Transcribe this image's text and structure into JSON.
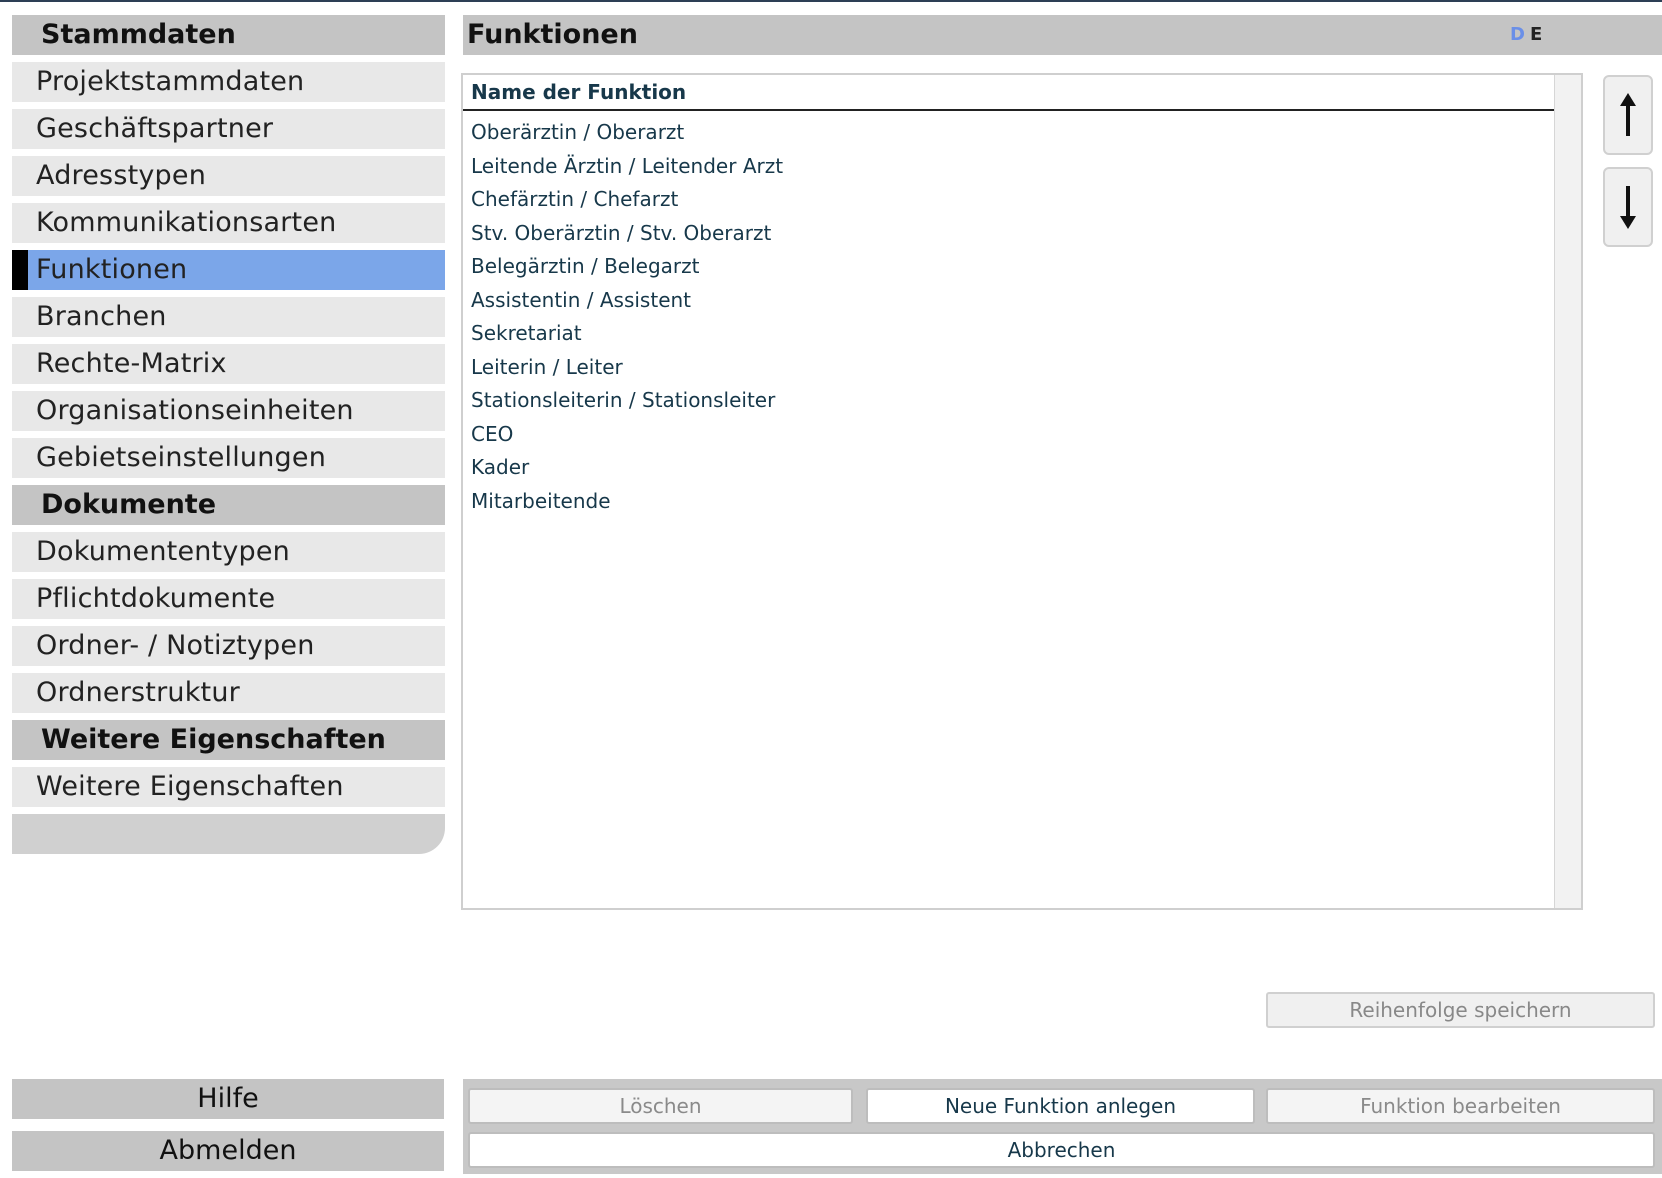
{
  "sidebar": {
    "sections": [
      {
        "title": "Stammdaten",
        "items": [
          "Projektstammdaten",
          "Geschäftspartner",
          "Adresstypen",
          "Kommunikationsarten",
          "Funktionen",
          "Branchen",
          "Rechte-Matrix",
          "Organisationseinheiten",
          "Gebietseinstellungen"
        ]
      },
      {
        "title": "Dokumente",
        "items": [
          "Dokumententypen",
          "Pflichtdokumente",
          "Ordner- / Notiztypen",
          "Ordnerstruktur"
        ]
      },
      {
        "title": "Weitere Eigenschaften",
        "items": [
          "Weitere Eigenschaften"
        ]
      }
    ],
    "active_item": "Funktionen",
    "help_label": "Hilfe",
    "logout_label": "Abmelden"
  },
  "main": {
    "title": "Funktionen",
    "lang_d": "D",
    "lang_e": "E",
    "list": {
      "column_header": "Name der Funktion",
      "rows": [
        "Oberärztin / Oberarzt",
        "Leitende Ärztin / Leitender Arzt",
        "Chefärztin / Chefarzt",
        "Stv. Oberärztin / Stv. Oberarzt",
        "Belegärztin / Belegarzt",
        "Assistentin / Assistent",
        "Sekretariat",
        "Leiterin / Leiter",
        "Stationsleiterin / Stationsleiter",
        "CEO",
        "Kader",
        "Mitarbeitende"
      ]
    },
    "move_up_icon": "arrow-up-icon",
    "move_down_icon": "arrow-down-icon",
    "save_order_label": "Reihenfolge speichern",
    "actions": {
      "delete_label": "Löschen",
      "new_label": "Neue Funktion anlegen",
      "edit_label": "Funktion bearbeiten",
      "cancel_label": "Abbrechen"
    }
  }
}
